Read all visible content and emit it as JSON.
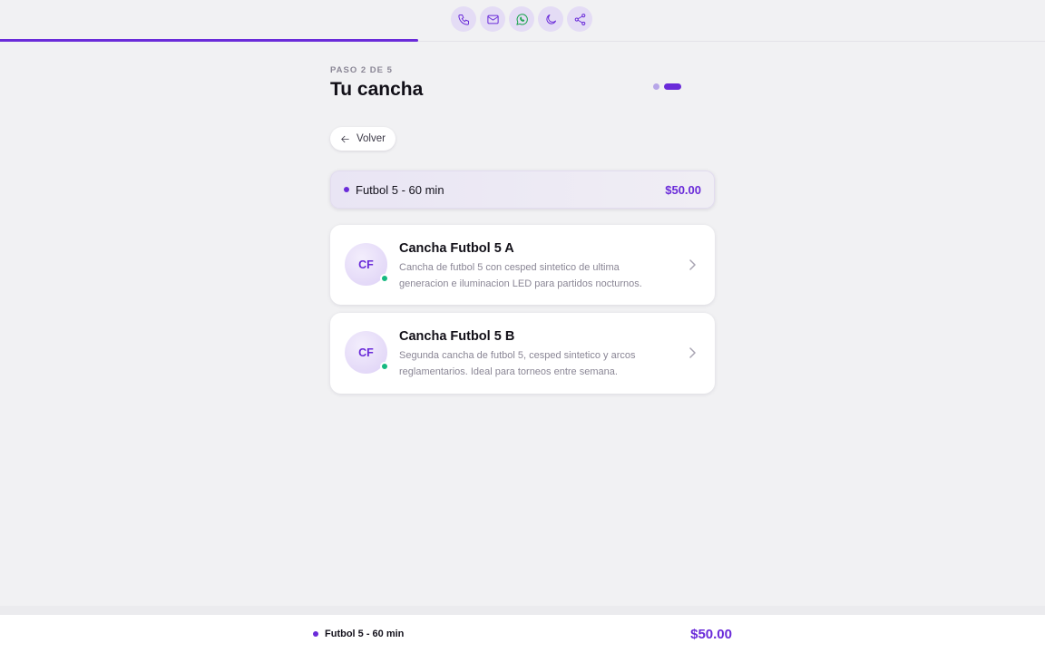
{
  "progress": {
    "value_pct": 40
  },
  "actions": [
    {
      "name": "phone",
      "icon": "phone-icon"
    },
    {
      "name": "email",
      "icon": "mail-icon"
    },
    {
      "name": "whatsapp",
      "icon": "whatsapp-icon"
    },
    {
      "name": "theme",
      "icon": "moon-icon"
    },
    {
      "name": "share",
      "icon": "share-icon"
    }
  ],
  "header": {
    "step_label": "PASO 2 DE 5",
    "title": "Tu cancha"
  },
  "back": {
    "label": "Volver"
  },
  "summary": {
    "label": "Futbol 5 - 60 min",
    "price": "$50.00"
  },
  "courts": [
    {
      "initials": "CF",
      "name": "Cancha Futbol 5 A",
      "description": "Cancha de futbol 5 con cesped sintetico de ultima generacion e iluminacion LED para partidos nocturnos.",
      "status": "available"
    },
    {
      "initials": "CF",
      "name": "Cancha Futbol 5 B",
      "description": "Segunda cancha de futbol 5, cesped sintetico y arcos reglamentarios. Ideal para torneos entre semana.",
      "status": "available"
    }
  ],
  "footer": {
    "label": "Futbol 5 - 60 min",
    "price": "$50.00"
  },
  "colors": {
    "accent": "#6a2bd9",
    "status_available": "#16b981",
    "whatsapp": "#16a34a"
  }
}
